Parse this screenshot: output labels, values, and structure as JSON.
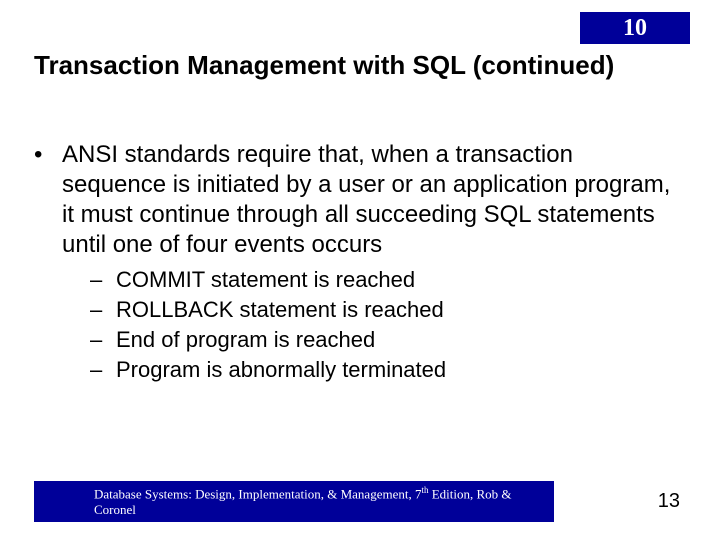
{
  "chapter_number": "10",
  "slide_title": "Transaction Management with SQL (continued)",
  "main_bullet": "ANSI standards require that, when a transaction sequence is initiated by a user or an application program, it must continue through all succeeding SQL statements until one of four events occurs",
  "sub_bullets": [
    "COMMIT statement is reached",
    "ROLLBACK statement is reached",
    "End of program is reached",
    "Program is abnormally terminated"
  ],
  "footer_prefix": "Database Systems: Design, Implementation, & Management, 7",
  "footer_ordinal": "th",
  "footer_suffix": " Edition, Rob & Coronel",
  "page_number": "13"
}
